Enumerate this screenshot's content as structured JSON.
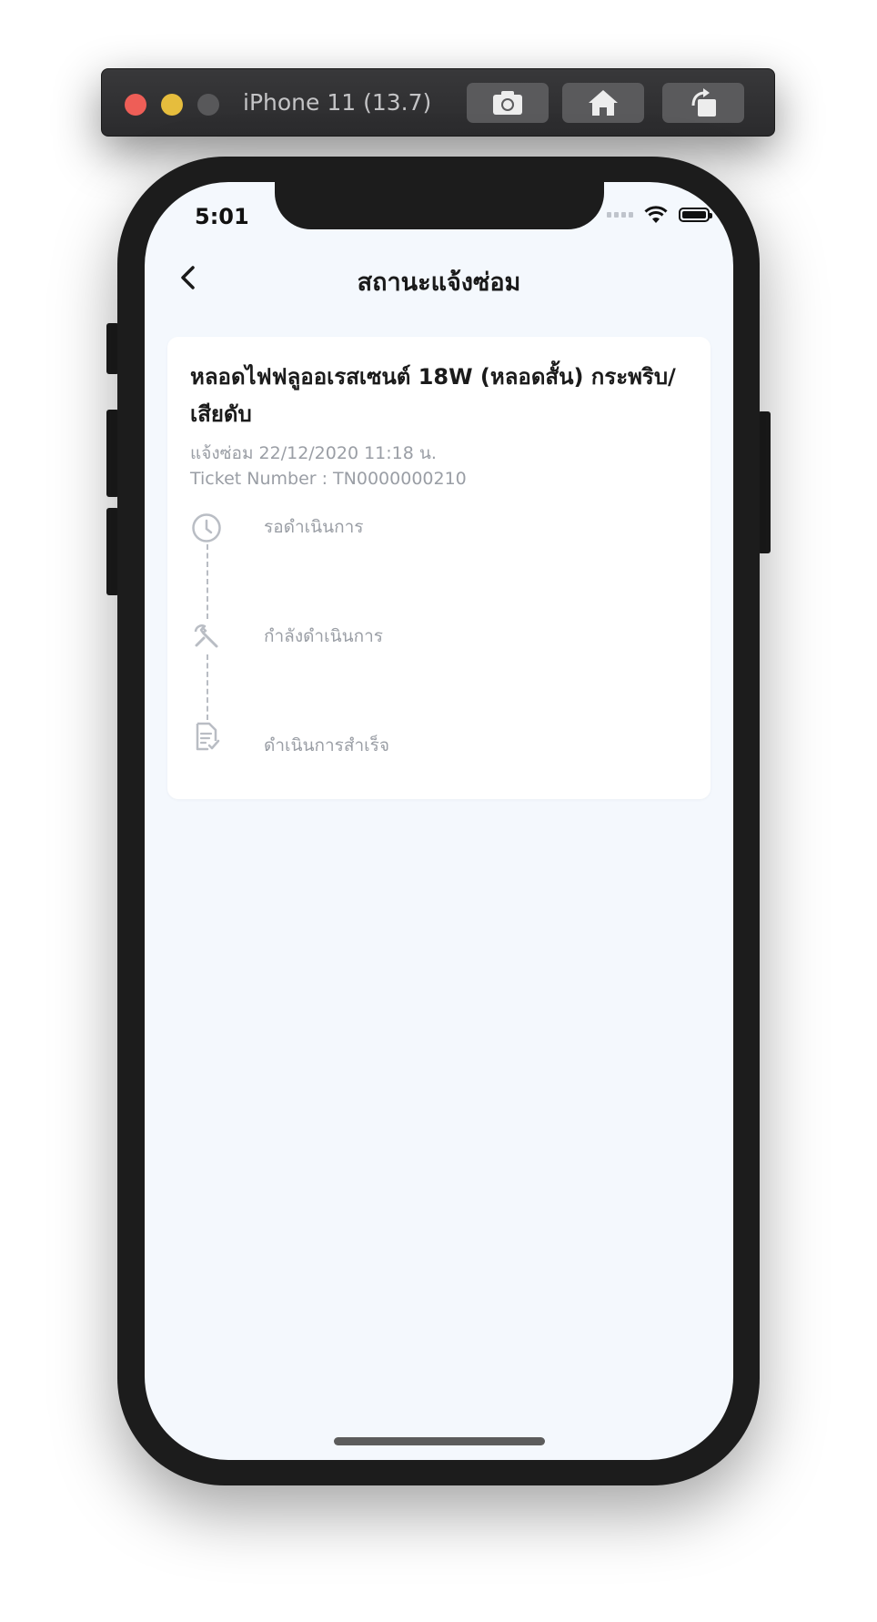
{
  "simulator": {
    "title": "iPhone 11 (13.7)",
    "buttons": [
      {
        "icon": "camera-icon"
      },
      {
        "icon": "home-icon"
      },
      {
        "icon": "rotate-icon"
      }
    ]
  },
  "status_bar": {
    "time": "5:01",
    "icons": [
      "signal-icon",
      "wifi-icon",
      "battery-icon"
    ]
  },
  "nav": {
    "title": "สถานะแจ้งซ่อม",
    "back_icon": "chevron-left-icon"
  },
  "ticket": {
    "title": "หลอดไฟฟลูออเรสเซนต์ 18W (หลอดสั้น) กระพริบ/เสียดับ",
    "reported": "แจ้งซ่อม 22/12/2020 11:18 น.",
    "ticket_number": "Ticket Number : TN0000000210",
    "steps": [
      {
        "label": "รอดำเนินการ",
        "icon": "clock-icon"
      },
      {
        "label": "กำลังดำเนินการ",
        "icon": "wrench-icon"
      },
      {
        "label": "ดำเนินการสำเร็จ",
        "icon": "document-check-icon"
      }
    ]
  },
  "colors": {
    "screen_background": "#f4f8fd",
    "card_background": "#ffffff",
    "muted_text": "#9a9ea5",
    "title_text": "#1b1b1b"
  }
}
